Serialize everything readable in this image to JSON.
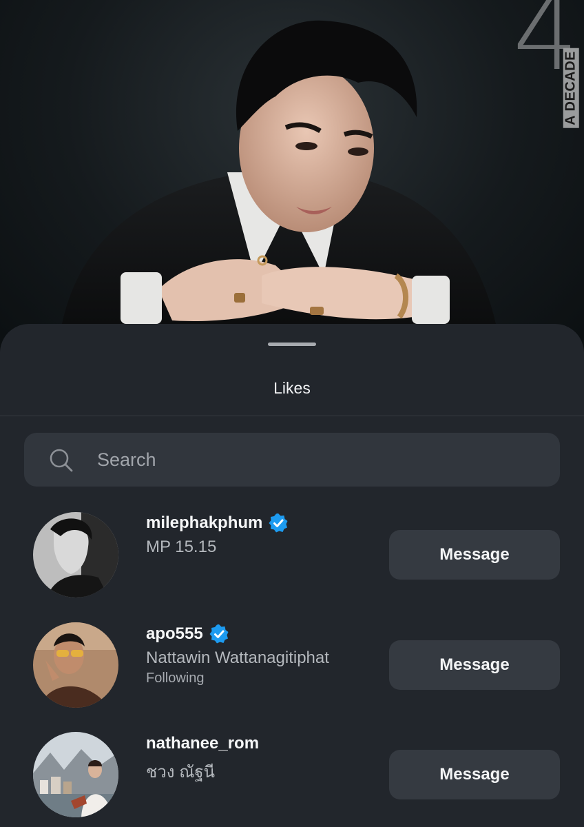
{
  "post": {
    "brand_number": "4",
    "brand_text": "A DECADE"
  },
  "sheet": {
    "title": "Likes",
    "search": {
      "placeholder": "Search",
      "value": ""
    },
    "users": [
      {
        "username": "milephakphum",
        "verified": true,
        "full_name": "MP 15.15",
        "status": "",
        "button": "Message"
      },
      {
        "username": "apo555",
        "verified": true,
        "full_name": "Nattawin Wattanagitiphat",
        "status": "Following",
        "button": "Message"
      },
      {
        "username": "nathanee_rom",
        "verified": false,
        "full_name": "ชวง ณัฐนี",
        "status": "",
        "button": "Message"
      }
    ]
  },
  "colors": {
    "sheet_bg": "#22262c",
    "button_bg": "#353a41",
    "verified_blue": "#1d9bf0"
  }
}
